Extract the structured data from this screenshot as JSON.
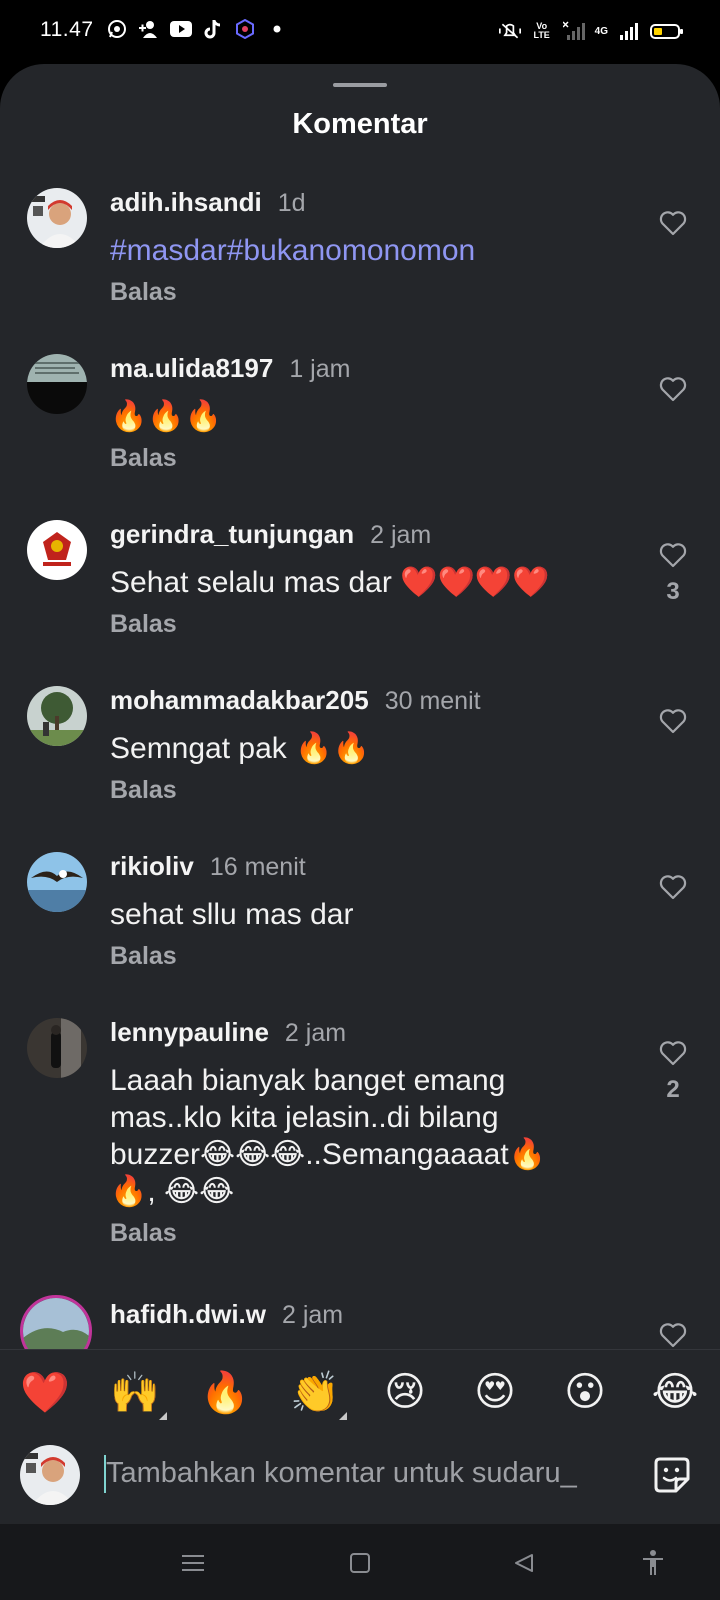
{
  "status_bar": {
    "time": "11.47",
    "left_icons": [
      "whatsapp-icon",
      "add-person-icon",
      "youtube-icon",
      "tiktok-icon",
      "app-icon",
      "dot-icon"
    ],
    "right_icons": [
      "mute-vibrate-icon",
      "volte-icon",
      "signal-x-icon",
      "4g-signal-icon",
      "battery-icon"
    ],
    "volte": "Vo LTE",
    "network": "4G",
    "battery_level": 0.35,
    "battery_color": "#ffd400"
  },
  "sheet": {
    "title": "Komentar"
  },
  "comments": [
    {
      "user": "adih.ihsandi",
      "time": "1d",
      "text": "#masdar#bukanomonomon",
      "is_tag": true,
      "reply": "Balas",
      "likes": ""
    },
    {
      "user": "ma.ulida8197",
      "time": "1 jam",
      "text": "🔥🔥🔥",
      "is_tag": false,
      "reply": "Balas",
      "likes": ""
    },
    {
      "user": "gerindra_tunjungan",
      "time": "2 jam",
      "text": "Sehat selalu mas dar ❤️❤️❤️❤️",
      "is_tag": false,
      "reply": "Balas",
      "likes": "3"
    },
    {
      "user": "mohammadakbar205",
      "time": "30 menit",
      "text": "Semngat pak 🔥🔥",
      "is_tag": false,
      "reply": "Balas",
      "likes": ""
    },
    {
      "user": "rikioliv",
      "time": "16 menit",
      "text": "sehat sllu mas dar",
      "is_tag": false,
      "reply": "Balas",
      "likes": ""
    },
    {
      "user": "lennypauline",
      "time": "2 jam",
      "text": "Laaah bianyak banget emang mas..klo kita jelasin..di bilang buzzer😂😂😂..Semangaaaat🔥🔥, 😂😂",
      "is_tag": false,
      "reply": "Balas",
      "likes": "2"
    },
    {
      "user": "hafidh.dwi.w",
      "time": "2 jam",
      "text": "",
      "is_tag": false,
      "reply": "",
      "likes": ""
    }
  ],
  "emoji_bar": [
    "❤️",
    "🙌",
    "🔥",
    "👏",
    "😢",
    "😍",
    "😮",
    "😂"
  ],
  "input": {
    "placeholder": "Tambahkan komentar untuk sudaru_"
  },
  "nav_bar": [
    "menu-icon",
    "home-icon",
    "back-icon",
    "accessibility-icon"
  ],
  "colors": {
    "sheet_bg": "#24262a",
    "hashtag": "#8f96f2",
    "muted_text": "#a4a6ab",
    "caret": "#7fd3d0"
  }
}
